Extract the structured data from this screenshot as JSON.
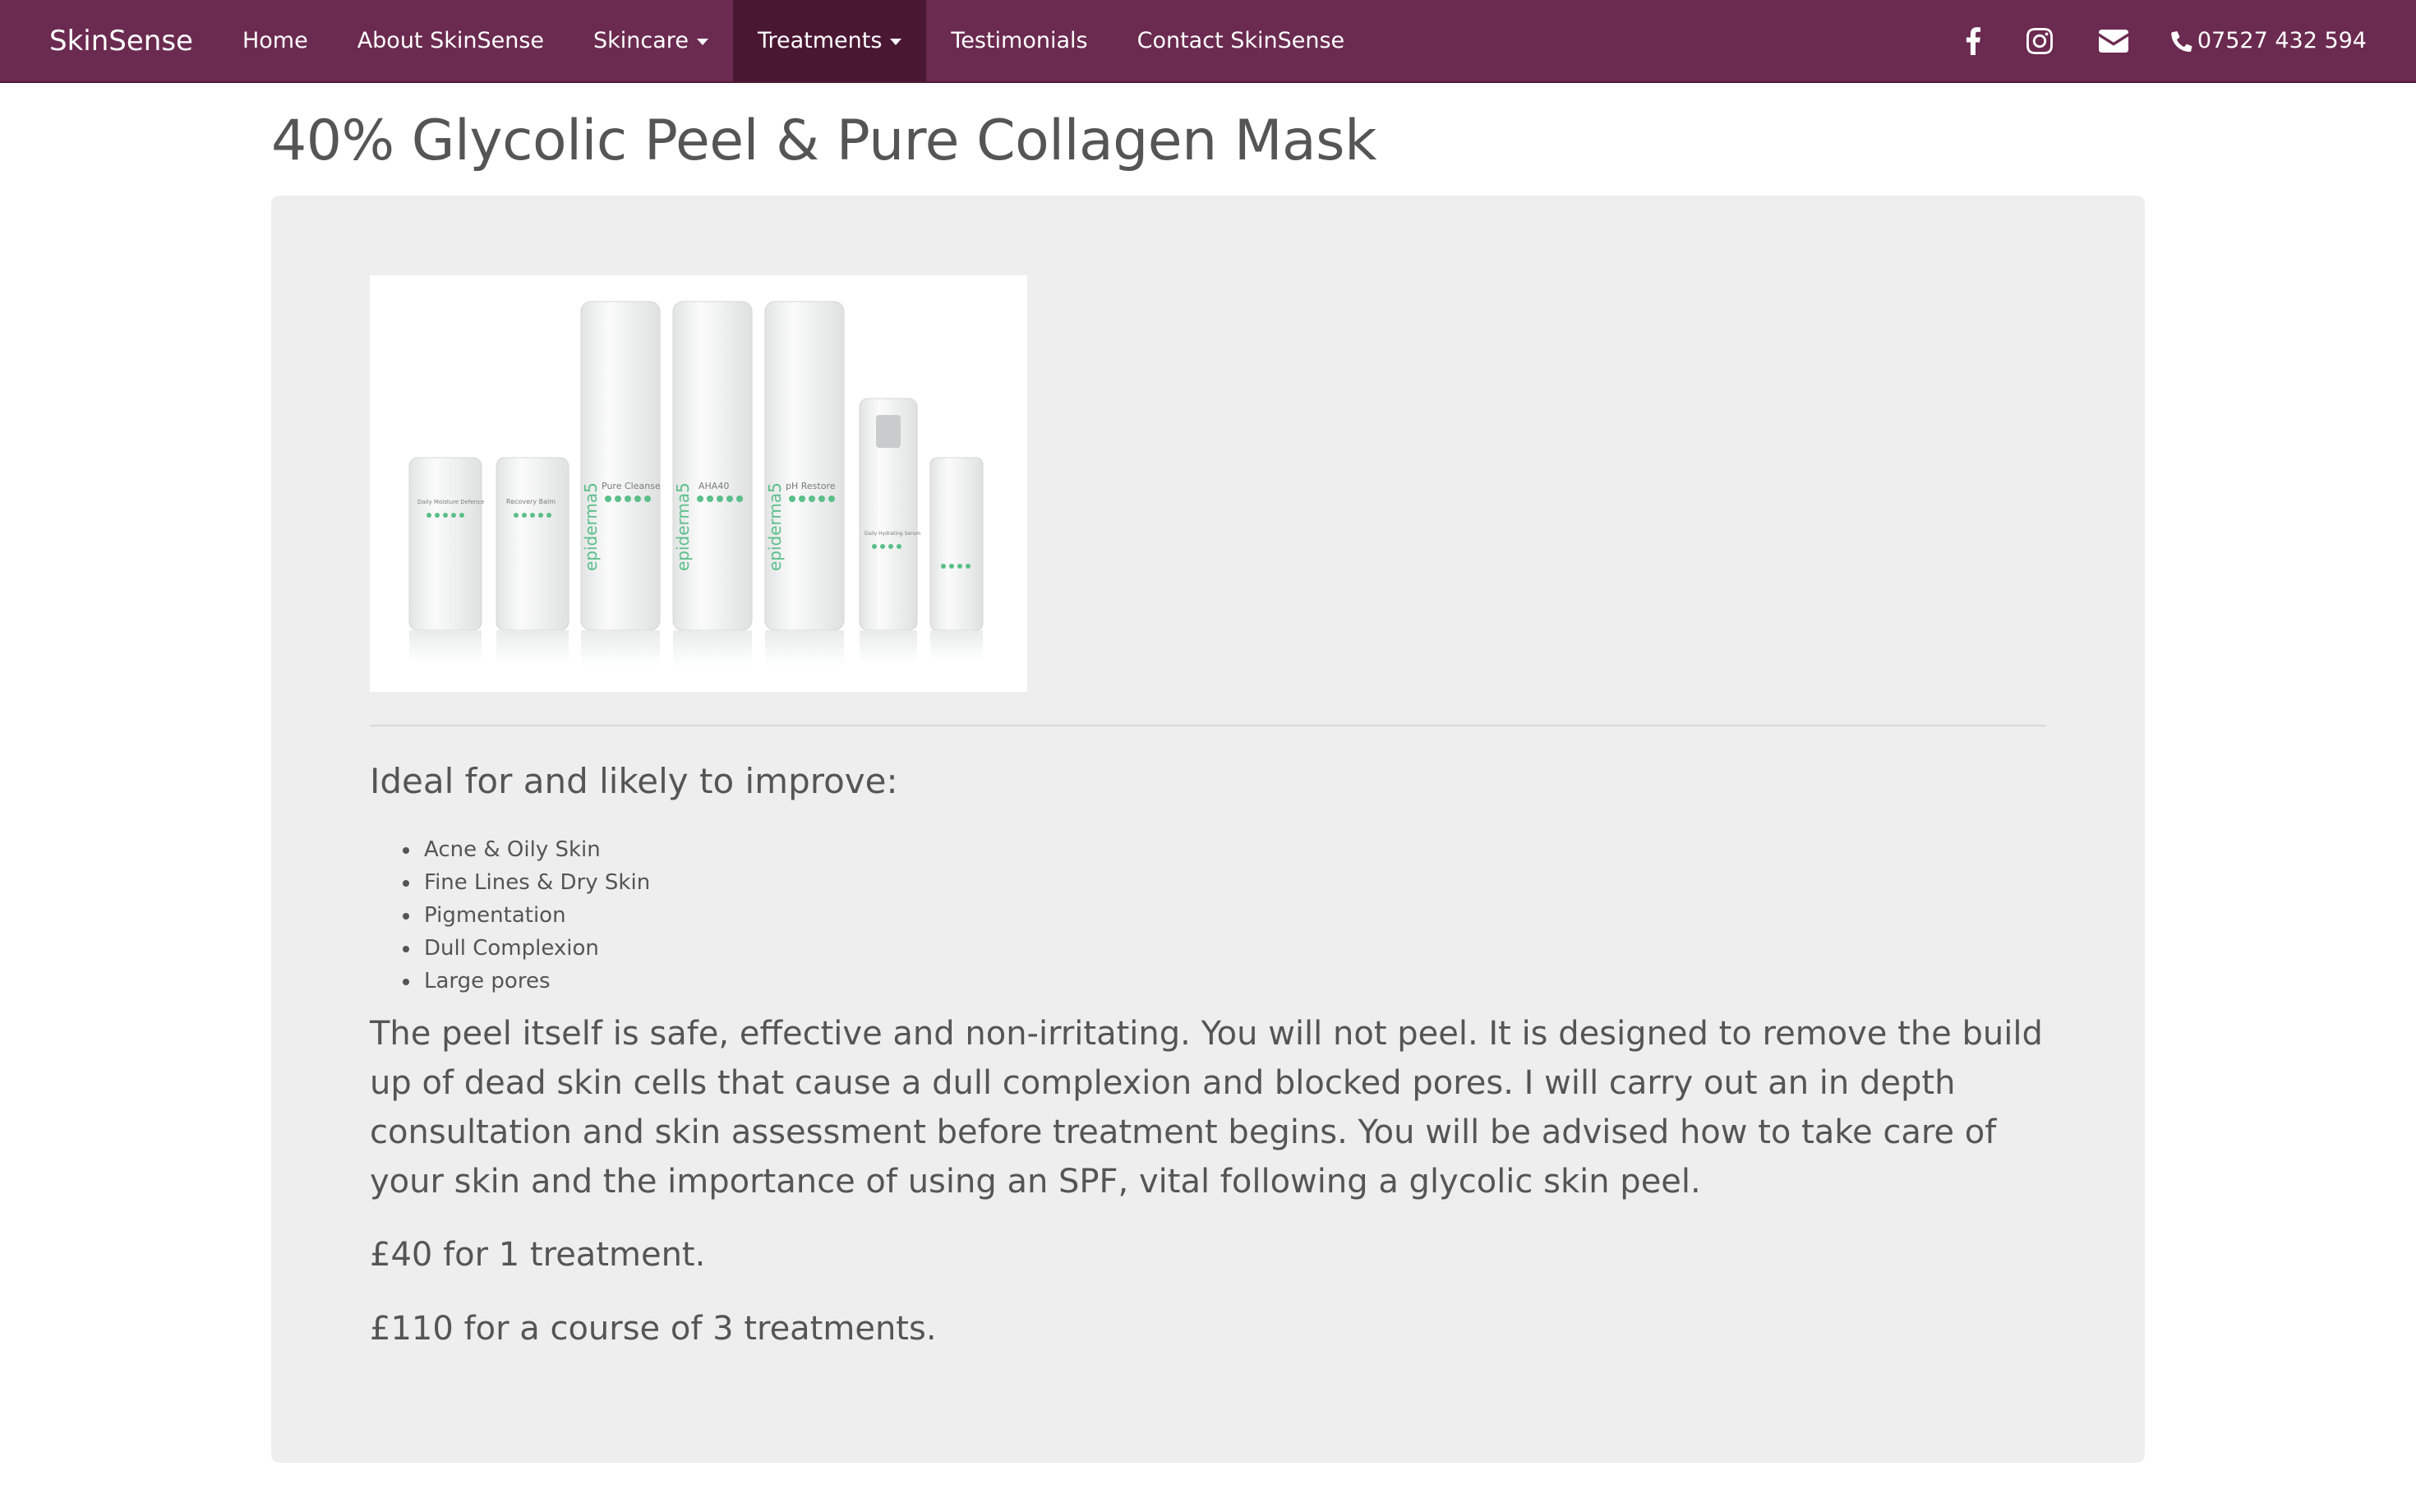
{
  "nav": {
    "brand": "SkinSense",
    "items": [
      {
        "label": "Home"
      },
      {
        "label": "About SkinSense"
      },
      {
        "label": "Skincare"
      },
      {
        "label": "Treatments"
      },
      {
        "label": "Testimonials"
      },
      {
        "label": "Contact SkinSense"
      }
    ],
    "social_icons": [
      "facebook-icon",
      "instagram-icon",
      "envelope-icon"
    ],
    "phone": "07527 432 594",
    "colors": {
      "bar": "#6b2a4f",
      "active": "#4a1733"
    }
  },
  "page": {
    "title": "40% Glycolic Peel & Pure Collagen Mask",
    "product_image": {
      "labels": [
        "Pure Cleanse",
        "AHA40",
        "pH Restore",
        "Daily Moisture Defence",
        "Recovery Balm",
        "Daily Hydrating Serum",
        "epiderma5"
      ]
    },
    "subheading": "Ideal for and likely to improve:",
    "benefits": [
      "Acne & Oily Skin",
      "Fine Lines & Dry Skin",
      "Pigmentation",
      "Dull Complexion",
      "Large pores"
    ],
    "description": "The peel itself is safe, effective and non-irritating. You will not peel. It is designed to remove the build up of dead skin cells that cause a dull complexion and blocked pores. I will carry out an in depth consultation and skin assessment before treatment begins. You will be advised how to take care of your skin and the importance of using an SPF, vital following a glycolic skin peel.",
    "price_single": "£40 for 1 treatment.",
    "price_course": "£110 for a course of 3 treatments."
  }
}
